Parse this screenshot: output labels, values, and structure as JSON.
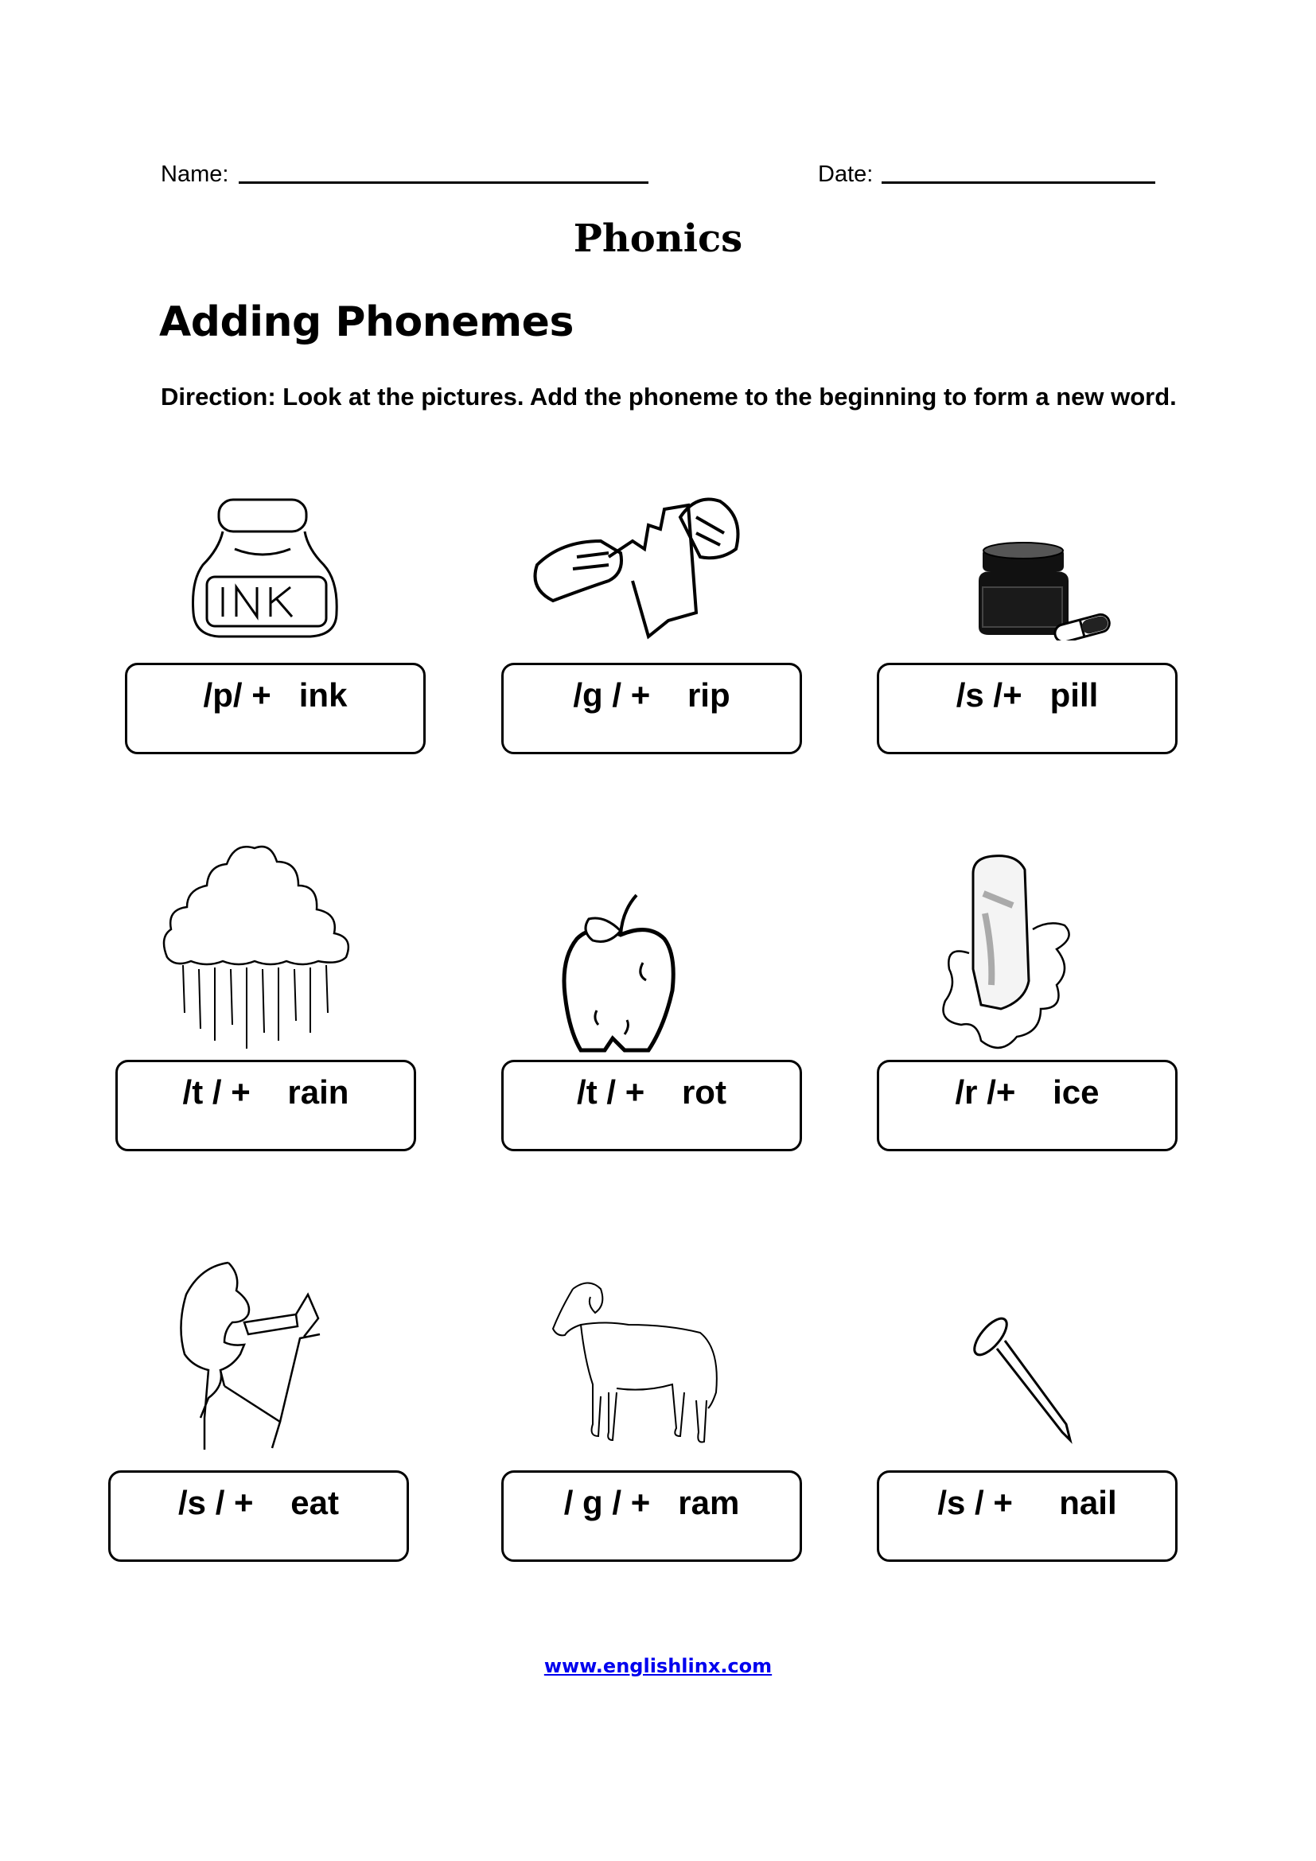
{
  "header": {
    "name_label": "Name:",
    "date_label": "Date:"
  },
  "title": "Phonics",
  "subtitle": "Adding Phonemes",
  "direction": "Direction: Look at the pictures. Add the phoneme to the beginning to form a new word.",
  "items": [
    {
      "picture": "ink-bottle-icon",
      "phoneme": "/p/ +",
      "word": "ink"
    },
    {
      "picture": "tearing-paper-icon",
      "phoneme": "/g / +",
      "word": "rip"
    },
    {
      "picture": "pill-bottle-icon",
      "phoneme": "/s /+",
      "word": "pill"
    },
    {
      "picture": "rain-cloud-icon",
      "phoneme": "/t / +",
      "word": "rain"
    },
    {
      "picture": "rotten-apple-icon",
      "phoneme": "/t / +",
      "word": "rot"
    },
    {
      "picture": "melting-ice-icon",
      "phoneme": "/r /+",
      "word": "ice"
    },
    {
      "picture": "boy-eating-icon",
      "phoneme": "/s / +",
      "word": "eat"
    },
    {
      "picture": "ram-icon",
      "phoneme": "/ g / +",
      "word": "ram"
    },
    {
      "picture": "nail-icon",
      "phoneme": "/s / +",
      "word": "nail"
    }
  ],
  "footer": {
    "link_text": "www.englishlinx.com"
  },
  "colors": {
    "link": "#0000ee",
    "text": "#000000"
  }
}
